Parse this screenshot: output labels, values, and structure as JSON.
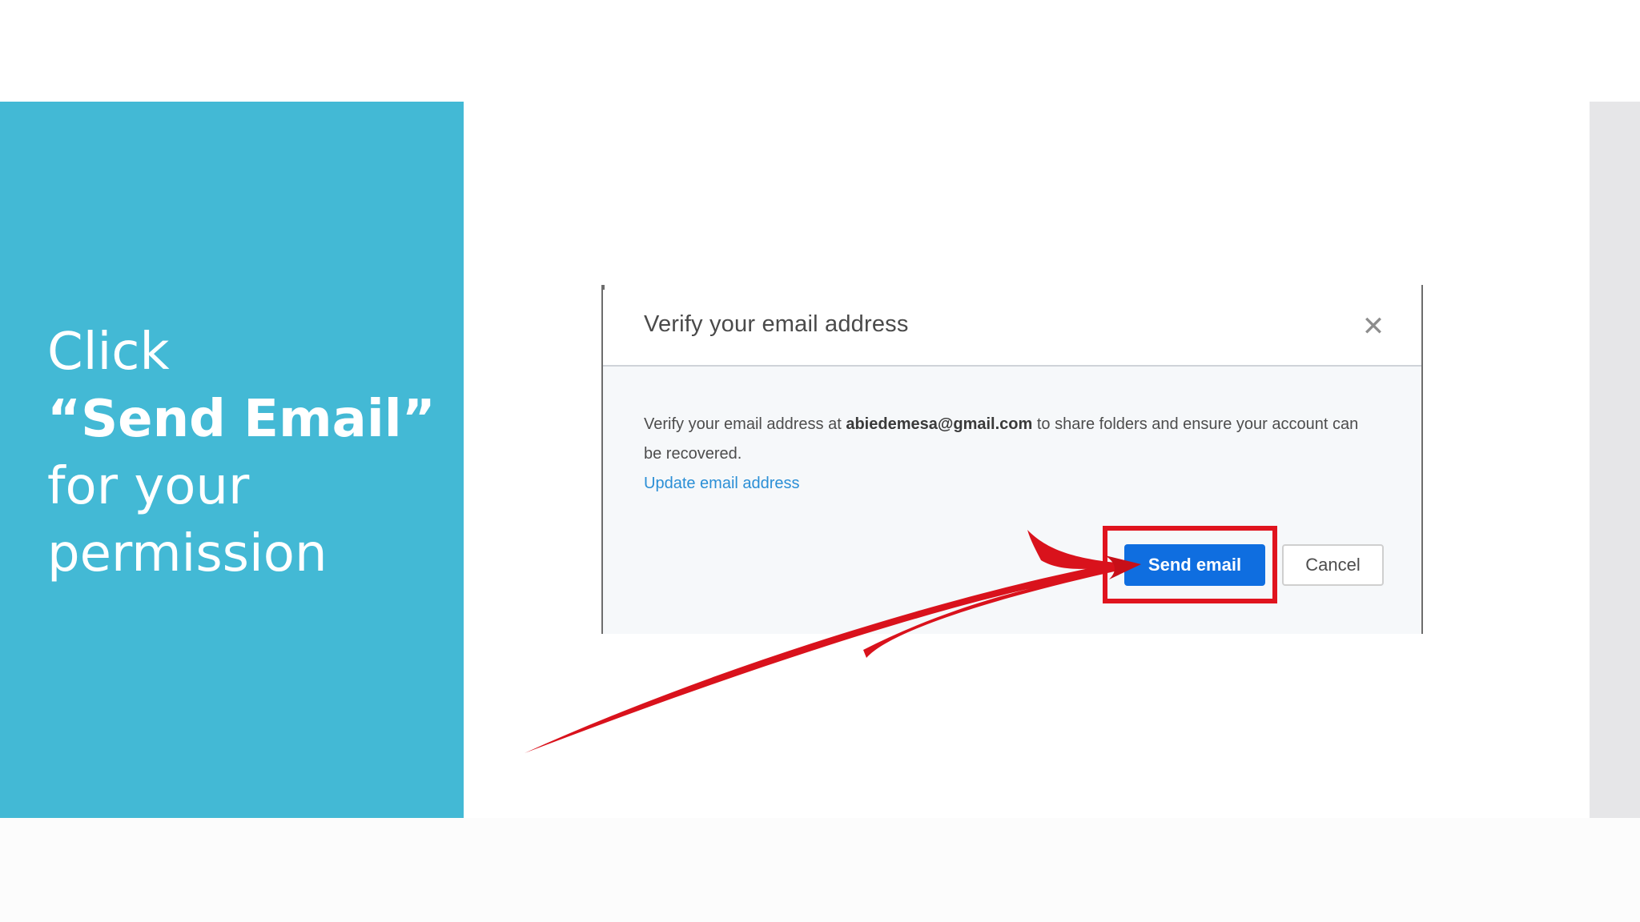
{
  "slide": {
    "line1": "Click",
    "line2": "“Send Email”",
    "line3": "for your",
    "line4": "permission",
    "panel_color": "#43b9d5"
  },
  "dialog": {
    "title": "Verify your email address",
    "close_icon": "close-icon",
    "body_prefix": "Verify your email address at ",
    "email": "abiedemesa@gmail.com",
    "body_suffix": " to share folders and ensure your account can be recovered.",
    "update_link": "Update email address",
    "send_button": "Send email",
    "cancel_button": "Cancel",
    "accent_color": "#0f6ee0",
    "link_color": "#2b8fd6"
  },
  "annotation": {
    "arrow_icon": "red-arrow",
    "highlight_color": "#e0141e"
  }
}
